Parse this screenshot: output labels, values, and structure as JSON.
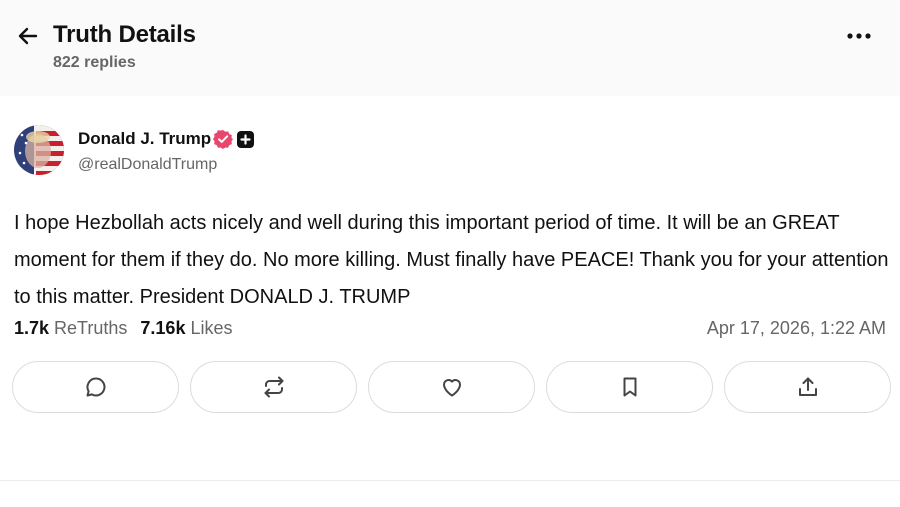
{
  "header": {
    "title": "Truth Details",
    "replies": "822 replies",
    "back_icon": "arrow-left-icon",
    "more_icon": "more-horizontal-icon"
  },
  "post": {
    "author": {
      "display_name": "Donald J. Trump",
      "handle": "@realDonaldTrump",
      "verified_badge_color": "#e8466c"
    },
    "text": "I hope Hezbollah acts nicely and well during this important period of time. It will be an GREAT moment for them if they do. No more killing. Must finally have PEACE! Thank you for your attention to this matter. President DONALD J. TRUMP",
    "retruths_count": "1.7k",
    "retruths_label": "ReTruths",
    "likes_count": "7.16k",
    "likes_label": "Likes",
    "timestamp": "Apr 17, 2026, 1:22 AM"
  },
  "actions": [
    {
      "name": "reply",
      "icon": "comment-icon"
    },
    {
      "name": "retruth",
      "icon": "repost-icon"
    },
    {
      "name": "like",
      "icon": "heart-icon"
    },
    {
      "name": "bookmark",
      "icon": "bookmark-icon"
    },
    {
      "name": "share",
      "icon": "share-icon"
    }
  ]
}
